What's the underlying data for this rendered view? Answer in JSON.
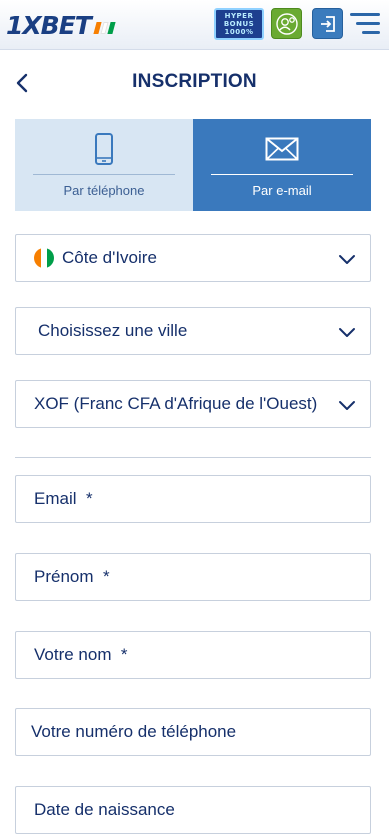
{
  "header": {
    "logo_text": "1XBET",
    "logo_flag_colors": [
      "#f77f00",
      "#ffffff",
      "#009e49"
    ],
    "promo_badge": {
      "line1": "HYPER",
      "line2": "BONUS",
      "line3": "1000%"
    },
    "icons": [
      "user-icon",
      "login-icon",
      "menu-icon"
    ],
    "colors": {
      "brand": "#1a3f83",
      "user_button": "#6aaa32",
      "login_button": "#3a7bbd"
    }
  },
  "page": {
    "title": "INSCRIPTION",
    "back_icon": "chevron-left-icon"
  },
  "tabs": [
    {
      "label": "Par téléphone",
      "icon": "phone-icon",
      "active": false
    },
    {
      "label": "Par e-mail",
      "icon": "envelope-icon",
      "active": true
    }
  ],
  "selects": {
    "country": {
      "value": "Côte d'Ivoire",
      "flag_colors": [
        "#f77f00",
        "#ffffff",
        "#009e49"
      ]
    },
    "city": {
      "value": "Choisissez une ville"
    },
    "currency": {
      "value": "XOF (Franc CFA d'Afrique de l'Ouest)"
    }
  },
  "inputs": {
    "email": {
      "placeholder": "Email  *"
    },
    "first_name": {
      "placeholder": "Prénom  *"
    },
    "last_name": {
      "placeholder": "Votre nom  *"
    },
    "phone": {
      "placeholder": "Votre numéro de téléphone"
    },
    "birth_date": {
      "placeholder": "Date de naissance"
    }
  },
  "colors": {
    "active_tab": "#3a79bd",
    "inactive_tab": "#d8e6f3",
    "text": "#16306b",
    "border": "#c7d0dd"
  }
}
